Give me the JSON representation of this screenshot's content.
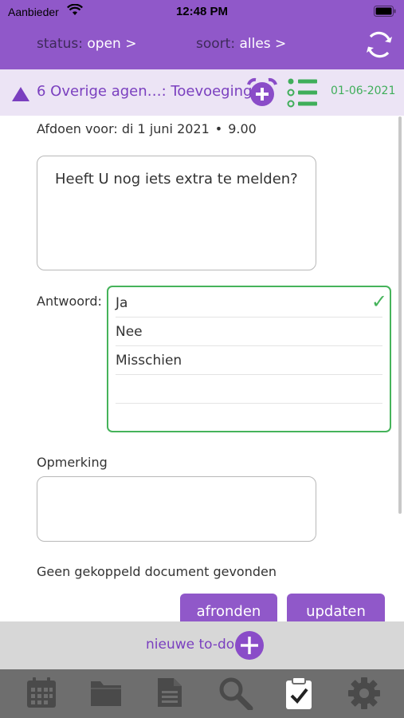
{
  "status_bar": {
    "carrier": "Aanbieder",
    "time": "12:48 PM"
  },
  "filters": {
    "status_label": "status:",
    "status_value": "open >",
    "soort_label": "soort:",
    "soort_value": "alles >"
  },
  "task": {
    "title": "6 Overige agen…: Toevoegingen",
    "date": "01-06-2021",
    "due_label": "Afdoen voor:",
    "due_date": "di 1 juni 2021",
    "due_sep": "•",
    "due_time": "9.00"
  },
  "question": {
    "text": "Heeft U nog iets extra te melden?"
  },
  "answer": {
    "label": "Antwoord:",
    "options": [
      "Ja",
      "Nee",
      "Misschien",
      "",
      ""
    ],
    "selected_check": "✓"
  },
  "remark": {
    "label": "Opmerking",
    "value": ""
  },
  "document": {
    "text": "Geen gekoppeld document gevonden"
  },
  "actions": {
    "afronden": "afronden",
    "updaten": "updaten"
  },
  "new_todo": {
    "label": "nieuwe to-do"
  },
  "tabs": [
    "calendar-icon",
    "folder-icon",
    "document-icon",
    "search-icon",
    "clipboard-check-icon",
    "settings-icon"
  ],
  "colors": {
    "brand_purple": "#9058c9",
    "accent_green": "#45b35a",
    "tabbar_gray": "#6e6e6e"
  }
}
